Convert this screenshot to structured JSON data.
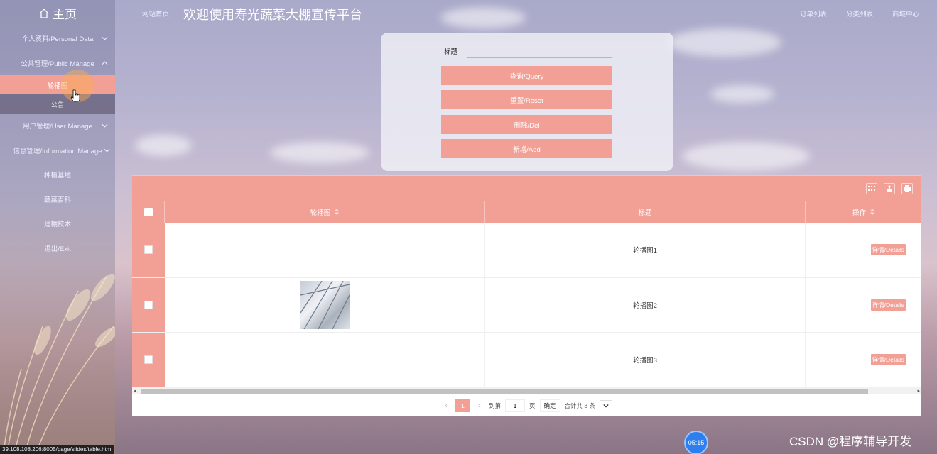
{
  "sidebar": {
    "home_label": "主页",
    "menu": [
      {
        "label": "个人资料/Personal Data"
      },
      {
        "label": "公共管理/Public Manage"
      },
      {
        "label": "用户管理/User Manage"
      },
      {
        "label": "信息管理/Information Manage"
      },
      {
        "label": "种植基地"
      },
      {
        "label": "蔬菜百科"
      },
      {
        "label": "建棚技术"
      },
      {
        "label": "退出/Exit"
      }
    ],
    "submenu": [
      {
        "label": "轮播图"
      },
      {
        "label": "公告"
      }
    ]
  },
  "topbar": {
    "site_home": "网站首页",
    "welcome": "欢迎使用寿光蔬菜大棚宣传平台",
    "links": [
      "订单列表",
      "分类列表",
      "商城中心"
    ]
  },
  "search": {
    "label": "标题",
    "value": "",
    "buttons": {
      "query": "查询/Query",
      "reset": "重置/Reset",
      "del": "删除/Del",
      "add": "新增/Add"
    }
  },
  "table": {
    "columns": {
      "image": "轮播图",
      "title": "标题",
      "operation": "操作"
    },
    "rows": [
      {
        "title": "轮播图1",
        "action": "详情/Details"
      },
      {
        "title": "轮播图2",
        "action": "详情/Details"
      },
      {
        "title": "轮播图3",
        "action": "详情/Details"
      }
    ]
  },
  "pager": {
    "current": "1",
    "goto_label": "到第",
    "goto_value": "1",
    "page_unit": "页",
    "confirm": "确定",
    "total": "合计共 3 条"
  },
  "status_url": "39.108.108.206:8005/page/slides/table.html",
  "timer": "05:15",
  "watermark": "CSDN @程序辅导开发",
  "colors": {
    "accent": "#f2a096"
  }
}
